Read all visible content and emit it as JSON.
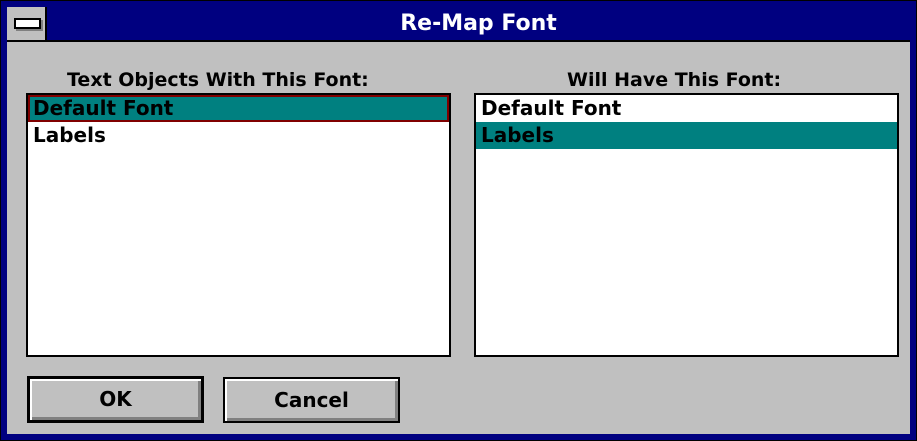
{
  "window": {
    "title": "Re-Map Font"
  },
  "left_list": {
    "label": "Text Objects With This Font:",
    "items": [
      "Default Font",
      "Labels"
    ],
    "selected": "Default Font"
  },
  "right_list": {
    "label": "Will Have This Font:",
    "items": [
      "Default Font",
      "Labels"
    ],
    "selected": "Labels"
  },
  "buttons": {
    "ok_label": "OK",
    "cancel_label": "Cancel"
  },
  "colors": {
    "title_bar": "#000080",
    "selection": "#008080",
    "face": "#c0c0c0"
  }
}
